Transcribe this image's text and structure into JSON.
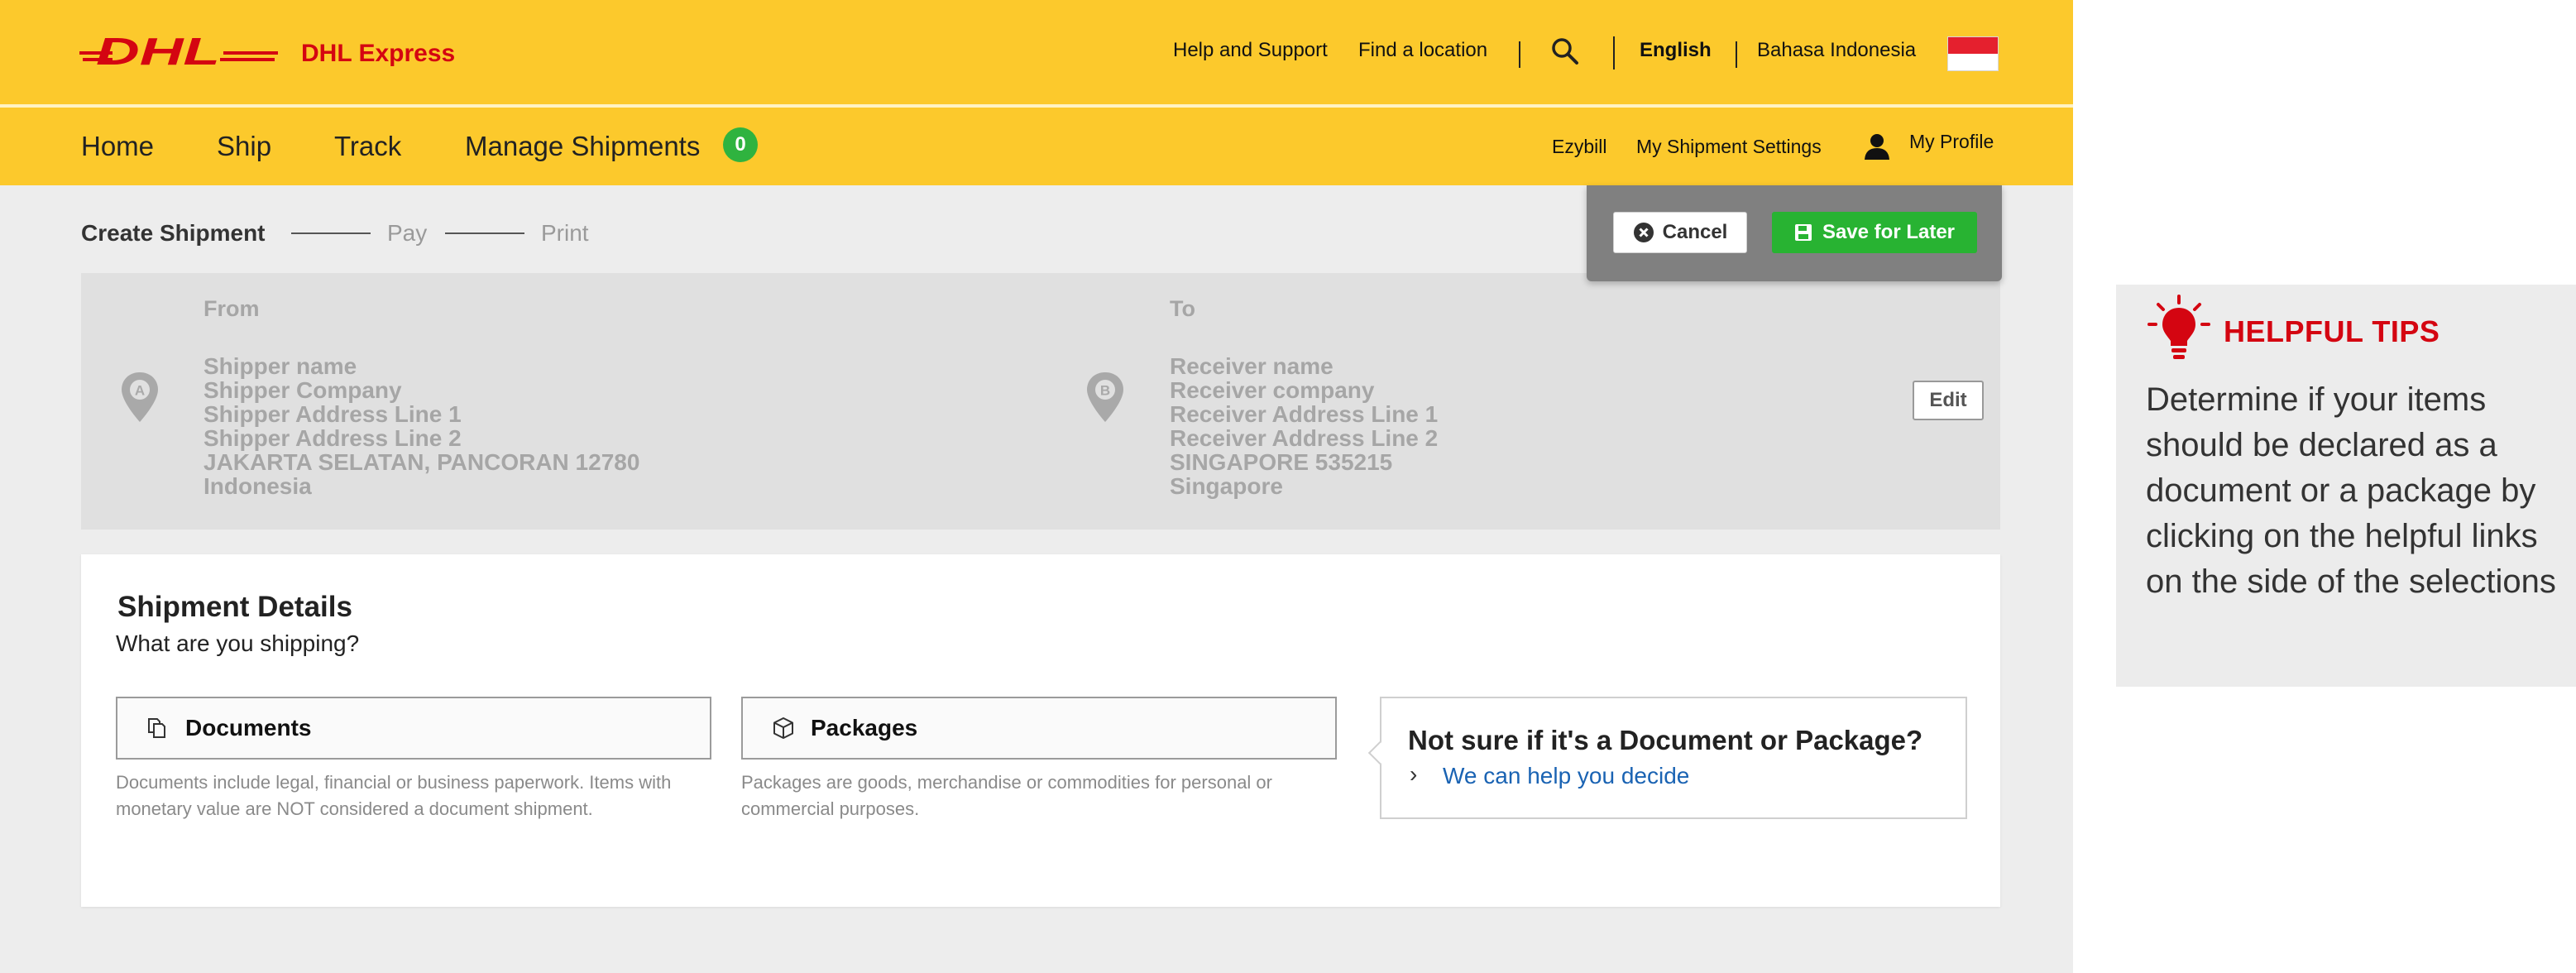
{
  "header": {
    "logo_text": "DHL",
    "brand": "DHL Express",
    "links": {
      "help": "Help and Support",
      "location": "Find a location",
      "lang_en": "English",
      "lang_id": "Bahasa Indonesia"
    }
  },
  "nav": {
    "home": "Home",
    "ship": "Ship",
    "track": "Track",
    "manage": "Manage Shipments",
    "manage_badge": "0",
    "ezybill": "Ezybill",
    "settings": "My Shipment Settings",
    "profile": "My Profile"
  },
  "steps": {
    "create": "Create Shipment",
    "pay": "Pay",
    "print": "Print"
  },
  "actions": {
    "cancel": "Cancel",
    "save": "Save for Later"
  },
  "address": {
    "from": {
      "label": "From",
      "pin": "A",
      "lines": [
        "Shipper name",
        "Shipper Company",
        "Shipper Address Line 1",
        "Shipper Address Line 2",
        "JAKARTA SELATAN, PANCORAN 12780",
        "Indonesia"
      ]
    },
    "to": {
      "label": "To",
      "pin": "B",
      "lines": [
        "Receiver name",
        "Receiver company",
        "Receiver Address Line 1",
        "Receiver Address Line 2",
        "SINGAPORE 535215",
        "Singapore"
      ]
    },
    "edit": "Edit"
  },
  "details": {
    "title": "Shipment Details",
    "subtitle": "What are you shipping?",
    "documents": {
      "label": "Documents",
      "desc": "Documents include legal, financial or business paperwork. Items with monetary value are NOT considered a document shipment."
    },
    "packages": {
      "label": "Packages",
      "desc": "Packages are goods, merchandise or commodities for personal or commercial purposes."
    },
    "help": {
      "question": "Not sure if it's a Document or Package?",
      "link": "We can help you decide"
    }
  },
  "tips": {
    "title": "HELPFUL TIPS",
    "text": "Determine if your items should be declared as a document or a package by clicking on the helpful links on the side of the selections"
  },
  "colors": {
    "dhl_yellow": "#fcc92c",
    "dhl_red": "#d40511",
    "save_green": "#28b332",
    "badge_green": "#2fb33f",
    "link_blue": "#1a63b3"
  },
  "icons": {
    "search": "search-icon",
    "profile": "user-icon",
    "cancel": "x-circle-icon",
    "save": "floppy-disk-icon",
    "pin": "map-pin-icon",
    "documents": "documents-icon",
    "packages": "package-box-icon",
    "chevron": "chevron-right-icon",
    "tip": "lightbulb-icon"
  }
}
